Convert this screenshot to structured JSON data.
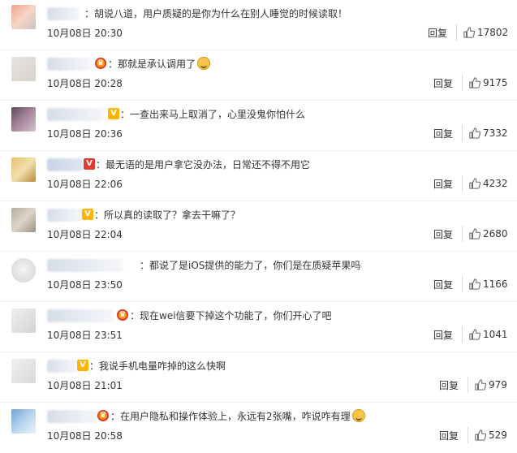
{
  "comments": [
    {
      "text": "：胡说八道，用户质疑的是你为什么在别人睡觉的时候读取！",
      "time": "10月08日 20:30",
      "reply": "回复",
      "likes": "17802",
      "emoji": false,
      "badge": "none"
    },
    {
      "text": "：那就是承认调用了",
      "time": "10月08日 20:28",
      "reply": "回复",
      "likes": "9175",
      "emoji": true,
      "badge": "crown"
    },
    {
      "text": "：一查出来马上取消了，心里没鬼你怕什么",
      "time": "10月08日 20:36",
      "reply": "回复",
      "likes": "7332",
      "emoji": false,
      "badge": "vip"
    },
    {
      "text": "：最无语的是用户拿它没办法，日常还不得不用它",
      "time": "10月08日 22:06",
      "reply": "回复",
      "likes": "4232",
      "emoji": false,
      "badge": "vred"
    },
    {
      "text": "：所以真的读取了？拿去干嘛了？",
      "time": "10月08日 22:04",
      "reply": "回复",
      "likes": "2680",
      "emoji": false,
      "badge": "vip"
    },
    {
      "text": "：都说了是iOS提供的能力了，你们是在质疑苹果吗",
      "time": "10月08日 23:50",
      "reply": "回复",
      "likes": "1166",
      "emoji": false,
      "badge": "none"
    },
    {
      "text": "：现在wei信要下掉这个功能了，你们开心了吧",
      "time": "10月08日 23:51",
      "reply": "回复",
      "likes": "1041",
      "emoji": false,
      "badge": "crown"
    },
    {
      "text": "：我说手机电量咋掉的这么快啊",
      "time": "10月08日 21:01",
      "reply": "回复",
      "likes": "979",
      "emoji": false,
      "badge": "vip"
    },
    {
      "text": "：在用户隐私和操作体验上，永远有2张嘴，咋说咋有理",
      "time": "10月08日 20:58",
      "reply": "回复",
      "likes": "529",
      "emoji": true,
      "badge": "crown"
    }
  ],
  "colors": {
    "link": "#5b8ec5",
    "text": "#333333",
    "divider": "#eeeeee"
  },
  "icons": {
    "like": "thumb-up-icon",
    "crown": "crown-badge-icon",
    "verified": "v-badge-icon",
    "emoji": "laughing-emoji-icon"
  }
}
